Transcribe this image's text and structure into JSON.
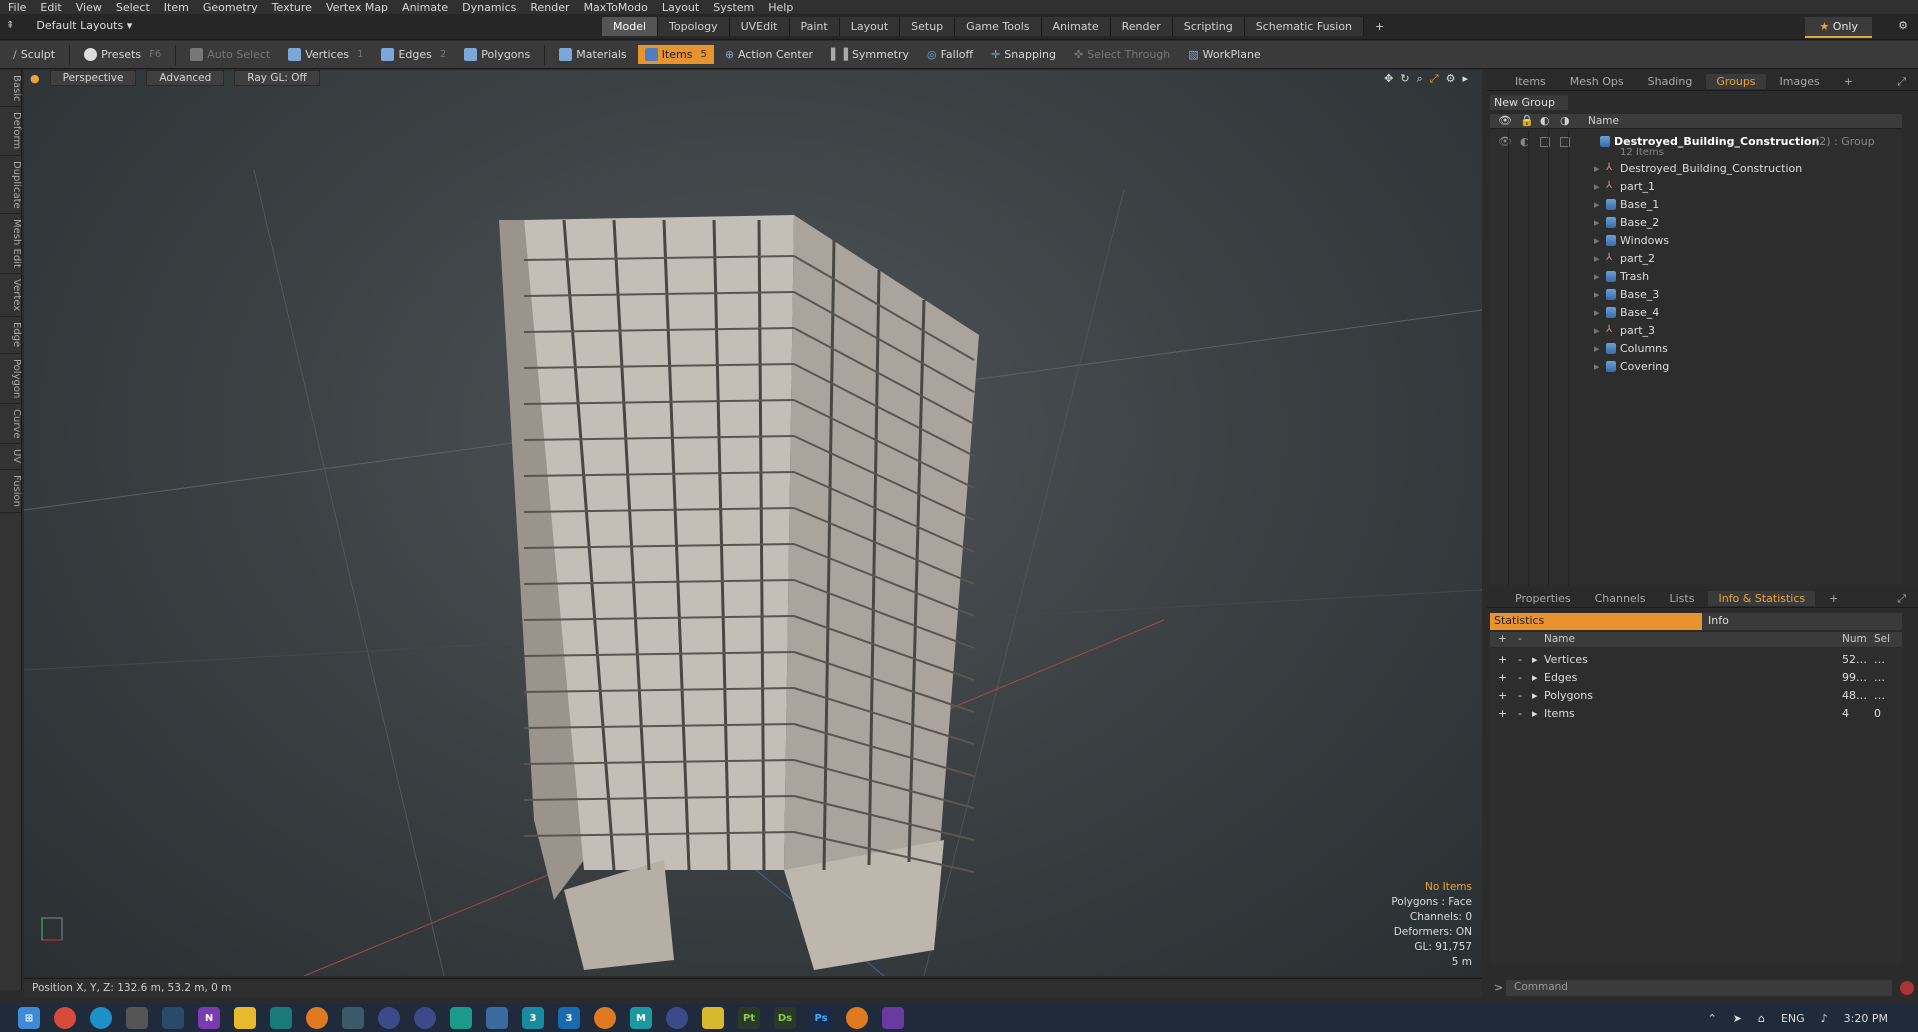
{
  "menu": [
    "File",
    "Edit",
    "View",
    "Select",
    "Item",
    "Geometry",
    "Texture",
    "Vertex Map",
    "Animate",
    "Dynamics",
    "Render",
    "MaxToModo",
    "Layout",
    "System",
    "Help"
  ],
  "layout": {
    "default_layouts": "Default Layouts",
    "tabs": [
      "Model",
      "Topology",
      "UVEdit",
      "Paint",
      "Layout",
      "Setup",
      "Game Tools",
      "Animate",
      "Render",
      "Scripting",
      "Schematic Fusion"
    ],
    "active_tab": "Model",
    "plus": "+",
    "only": "Only"
  },
  "toolbar": {
    "sculpt": "Sculpt",
    "presets": "Presets",
    "presets_key": "F6",
    "auto_select": "Auto Select",
    "vertices": "Vertices",
    "vertices_key": "1",
    "edges": "Edges",
    "edges_key": "2",
    "polygons": "Polygons",
    "materials": "Materials",
    "items": "Items",
    "items_key": "5",
    "action_center": "Action Center",
    "symmetry": "Symmetry",
    "falloff": "Falloff",
    "snapping": "Snapping",
    "select_through": "Select Through",
    "workplane": "WorkPlane"
  },
  "left_tabs": [
    "Basic",
    "Deform",
    "Duplicate",
    "Mesh Edit",
    "Vertex",
    "Edge",
    "Polygon",
    "Curve",
    "UV",
    "Fusion"
  ],
  "viewport": {
    "perspective": "Perspective",
    "advanced": "Advanced",
    "raygl": "Ray GL: Off",
    "info": {
      "no_items": "No Items",
      "polygons": "Polygons : Face",
      "channels": "Channels: 0",
      "deformers": "Deformers: ON",
      "gl": "GL: 91,757",
      "scale": "5 m"
    }
  },
  "status": {
    "position": "Position X, Y, Z:  132.6 m, 53.2 m, 0 m"
  },
  "top_panel": {
    "tabs": [
      "Items",
      "Mesh Ops",
      "Shading",
      "Groups",
      "Images"
    ],
    "active": "Groups",
    "plus": "+",
    "new_group": "New Group",
    "name_col": "Name",
    "group": {
      "name": "Destroyed_Building_Construction",
      "count": "(2)",
      "kind": ": Group",
      "items_count": "12 Items"
    },
    "items": [
      {
        "name": "Destroyed_Building_Construction",
        "type": "mesh-item"
      },
      {
        "name": "part_1",
        "type": "mesh-item"
      },
      {
        "name": "Base_1",
        "type": "group"
      },
      {
        "name": "Base_2",
        "type": "group"
      },
      {
        "name": "Windows",
        "type": "group"
      },
      {
        "name": "part_2",
        "type": "mesh-item"
      },
      {
        "name": "Trash",
        "type": "group"
      },
      {
        "name": "Base_3",
        "type": "group"
      },
      {
        "name": "Base_4",
        "type": "group"
      },
      {
        "name": "part_3",
        "type": "mesh-item"
      },
      {
        "name": "Columns",
        "type": "group"
      },
      {
        "name": "Covering",
        "type": "group"
      }
    ]
  },
  "bottom_panel": {
    "tabs": [
      "Properties",
      "Channels",
      "Lists",
      "Info & Statistics"
    ],
    "active": "Info & Statistics",
    "plus": "+",
    "statistics": "Statistics",
    "info": "Info",
    "cols": {
      "name": "Name",
      "num": "Num",
      "sel": "Sel"
    },
    "rows": [
      {
        "name": "Vertices",
        "num": "52…",
        "sel": "…"
      },
      {
        "name": "Edges",
        "num": "99…",
        "sel": "…"
      },
      {
        "name": "Polygons",
        "num": "48…",
        "sel": "…"
      },
      {
        "name": "Items",
        "num": "4",
        "sel": "0"
      }
    ]
  },
  "command": {
    "placeholder": "Command"
  },
  "taskbar": {
    "time": "3:20 PM",
    "lang": "ENG"
  }
}
